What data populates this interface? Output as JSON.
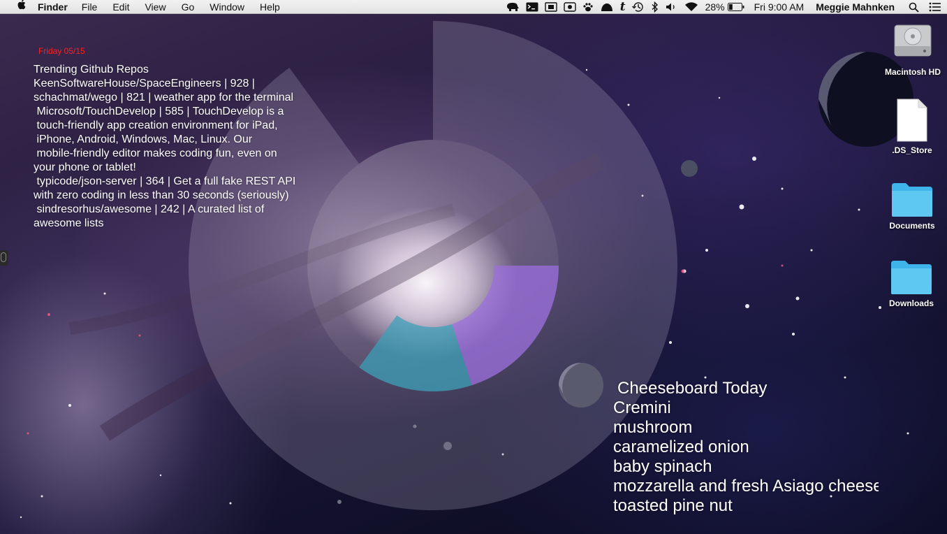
{
  "menubar": {
    "apple_glyph": "",
    "app_name": "Finder",
    "menus": [
      "File",
      "Edit",
      "View",
      "Go",
      "Window",
      "Help"
    ],
    "status_icons": [
      "evernote-elephant-icon",
      "terminal-icon",
      "screen-mirror-icon",
      "record-icon",
      "paw-icon",
      "cloud-hat-icon",
      "tumblr-icon",
      "time-machine-icon",
      "bluetooth-icon",
      "volume-icon",
      "wifi-icon"
    ],
    "battery_percent": "28%",
    "clock": "Fri 9:00 AM",
    "user": "Meggie Mahnken",
    "search_icon": "spotlight-search-icon",
    "notification_icon": "notification-center-icon"
  },
  "date_widget": {
    "text": "Friday 05/15"
  },
  "github_widget": {
    "title": "Trending Github Repos",
    "repos": [
      "KeenSoftwareHouse/SpaceEngineers | 928 |",
      "schachmat/wego | 821 | weather app for the terminal",
      " Microsoft/TouchDevelop | 585 | TouchDevelop is a\n touch-friendly app creation environment for iPad,\n iPhone, Android, Windows, Mac, Linux. Our\n mobile-friendly editor makes coding fun, even on\nyour phone or tablet!",
      " typicode/json-server | 364 | Get a full fake REST API\nwith zero coding in less than 30 seconds (seriously)",
      " sindresorhus/awesome | 242 | A curated list of\nawesome lists"
    ]
  },
  "cheese_widget": {
    "title": "Cheeseboard Today",
    "items": [
      "Cremini",
      "mushroom",
      "caramelized onion",
      "baby spinach",
      "mozzarella and fresh Asiago cheese",
      "toasted pine nut"
    ]
  },
  "desktop": {
    "icons": [
      {
        "label": "Macintosh HD",
        "kind": "hard-drive-icon"
      },
      {
        "label": ".DS_Store",
        "kind": "document-icon"
      },
      {
        "label": "Documents",
        "kind": "folder-icon"
      },
      {
        "label": "Downloads",
        "kind": "folder-icon"
      }
    ]
  },
  "ring_widget": {
    "outer_ring_fraction": 0.9,
    "inner_segments": [
      {
        "fraction": 0.2,
        "color": "#9b6fe0"
      },
      {
        "fraction": 0.15,
        "color": "#3aa0b8"
      }
    ]
  },
  "colors": {
    "menubar_bg": "#e8e8e8",
    "date_red": "#ff2020",
    "folder_blue": "#5ec8f2",
    "purple_segment": "#9b6fe0",
    "teal_segment": "#3aa0b8"
  }
}
